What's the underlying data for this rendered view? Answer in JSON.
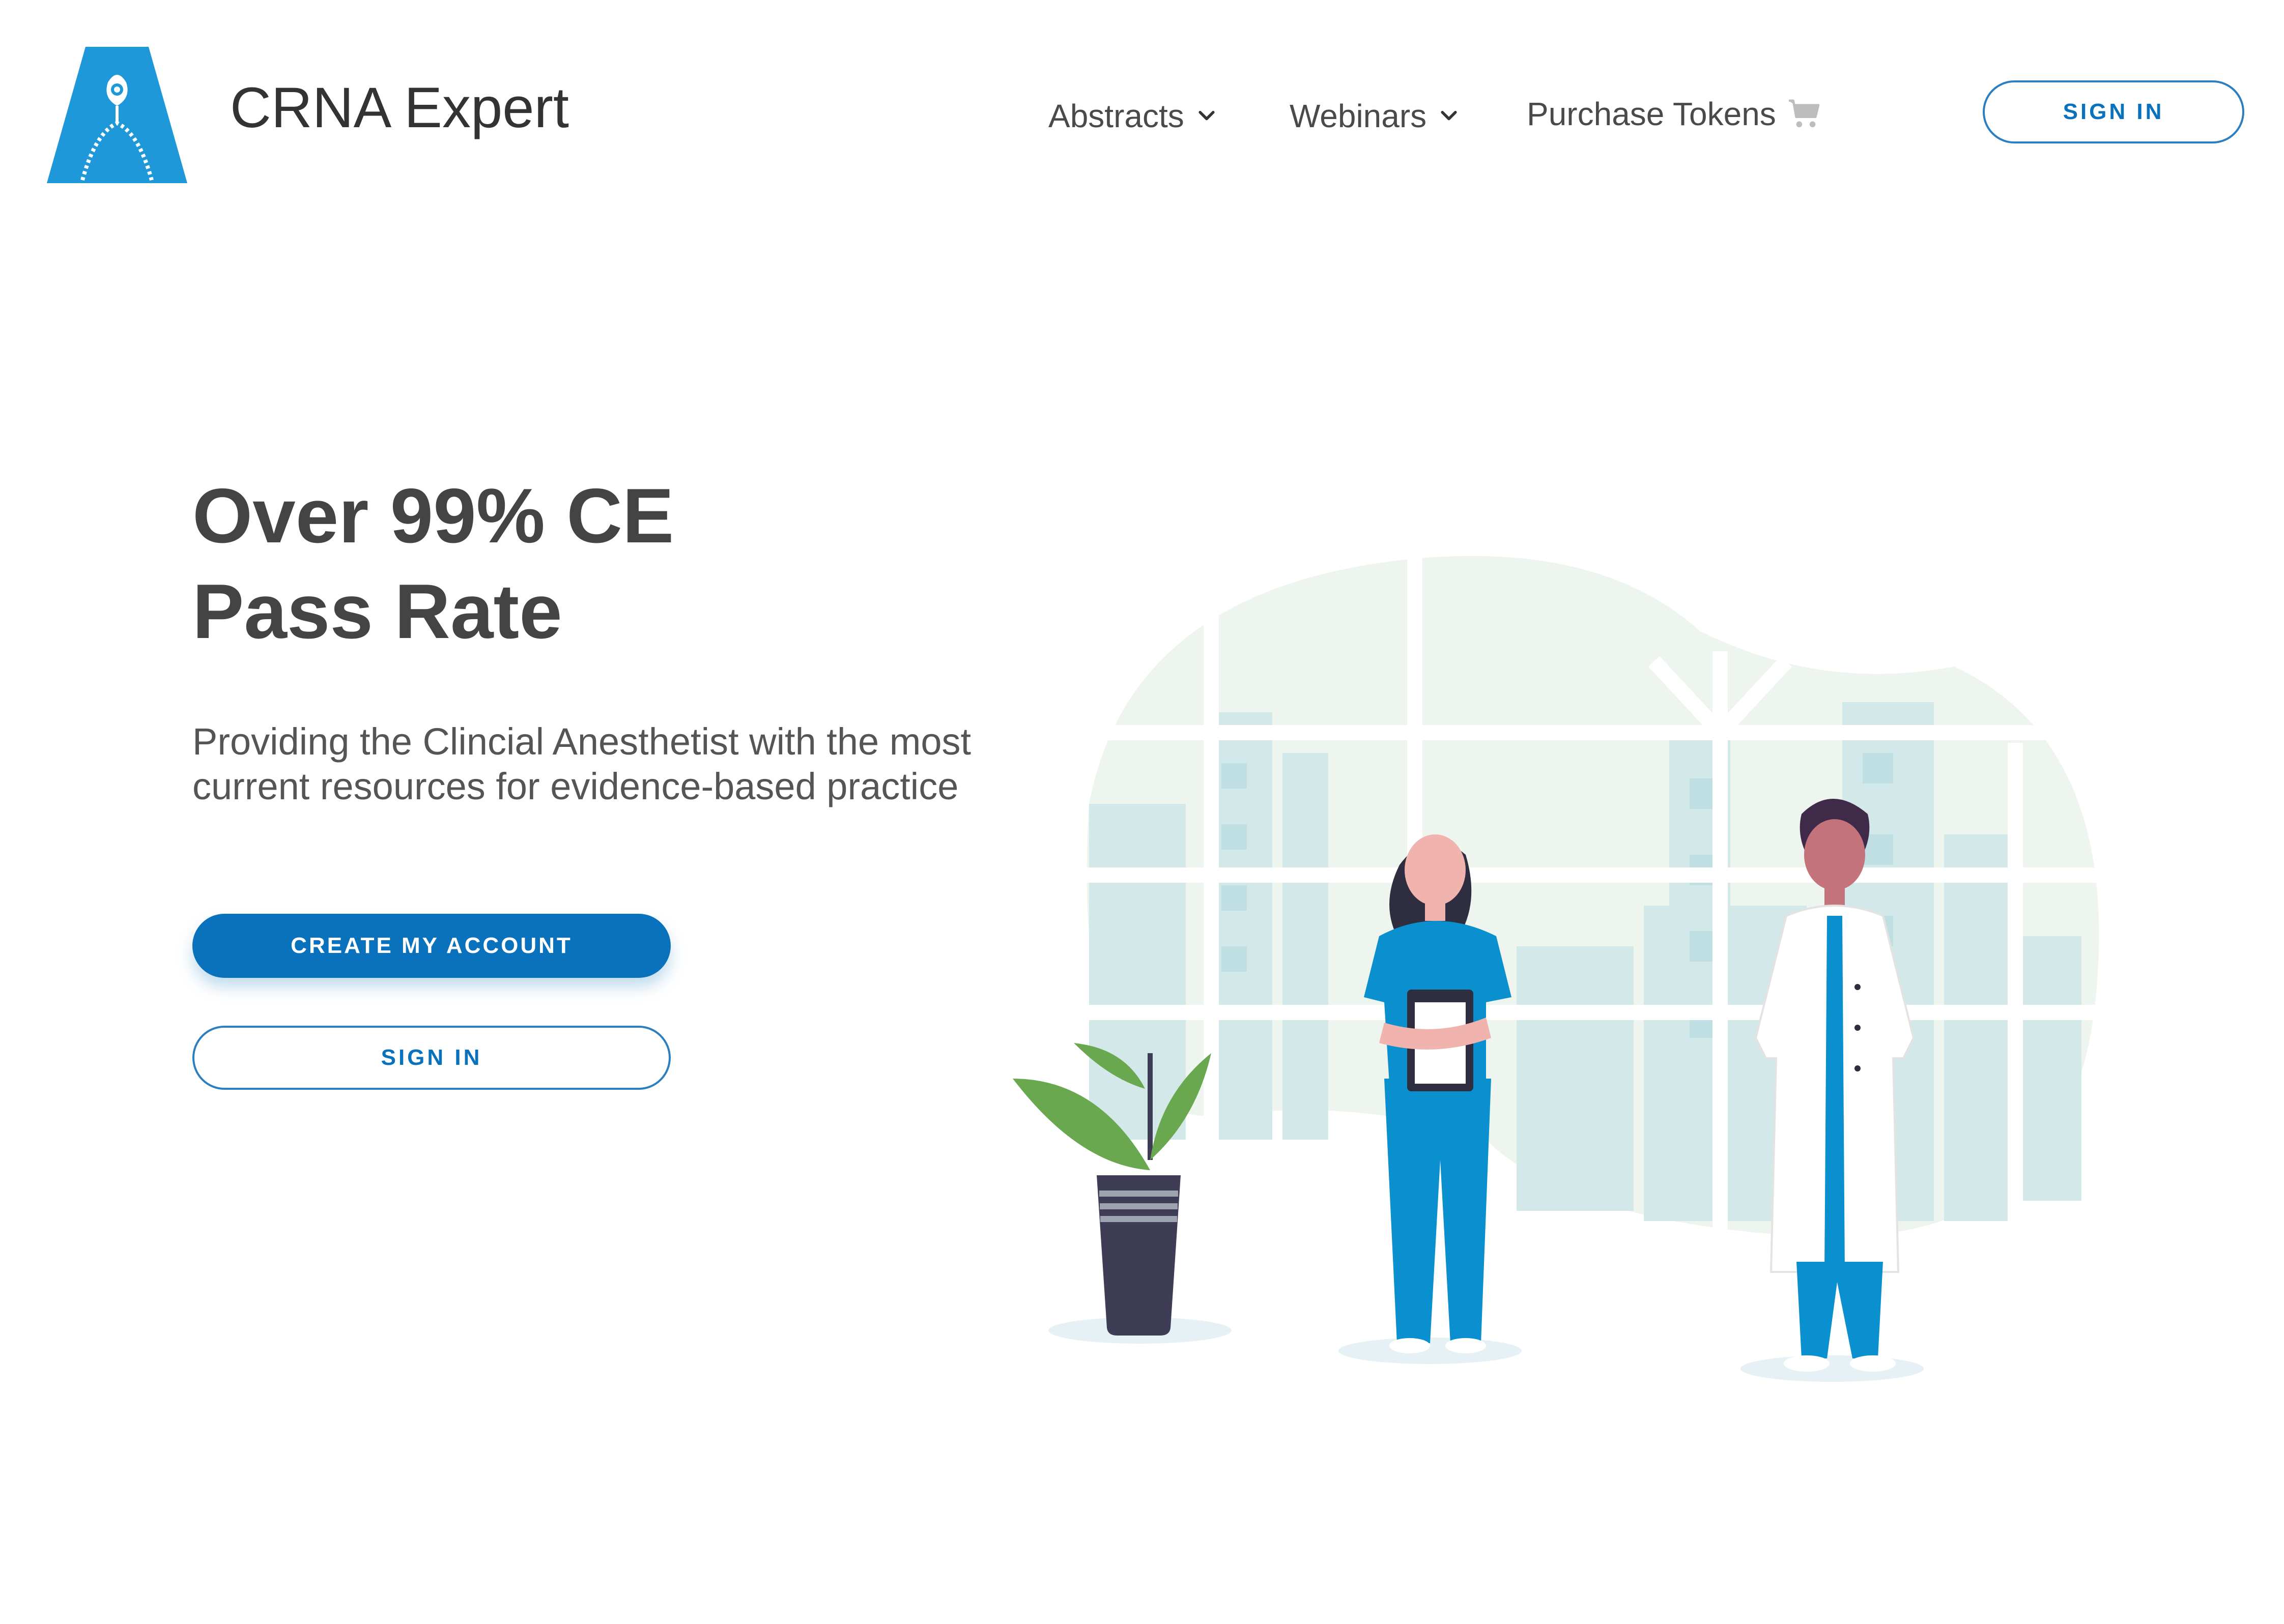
{
  "header": {
    "brand_name": "CRNA Expert",
    "logo_icon": "triangle-mask-logo-icon",
    "nav": [
      {
        "label": "Abstracts",
        "icon": "chevron-down-icon"
      },
      {
        "label": "Webinars",
        "icon": "chevron-down-icon"
      },
      {
        "label": "Purchase Tokens",
        "icon": "cart-icon"
      }
    ],
    "sign_in_label": "SIGN IN"
  },
  "hero": {
    "headline_line1": "Over 99% CE",
    "headline_line2": "Pass Rate",
    "subtext_line1": "Providing the Clincial Anesthetist with the most",
    "subtext_line2": "current resources for evidence-based practice",
    "create_account_label": "CREATE MY ACCOUNT",
    "sign_in_label": "SIGN IN",
    "illustration": "medical-staff-illustration"
  },
  "colors": {
    "brand_blue": "#0a72bd",
    "logo_blue": "#1e98d9",
    "text_dark": "#444444"
  }
}
